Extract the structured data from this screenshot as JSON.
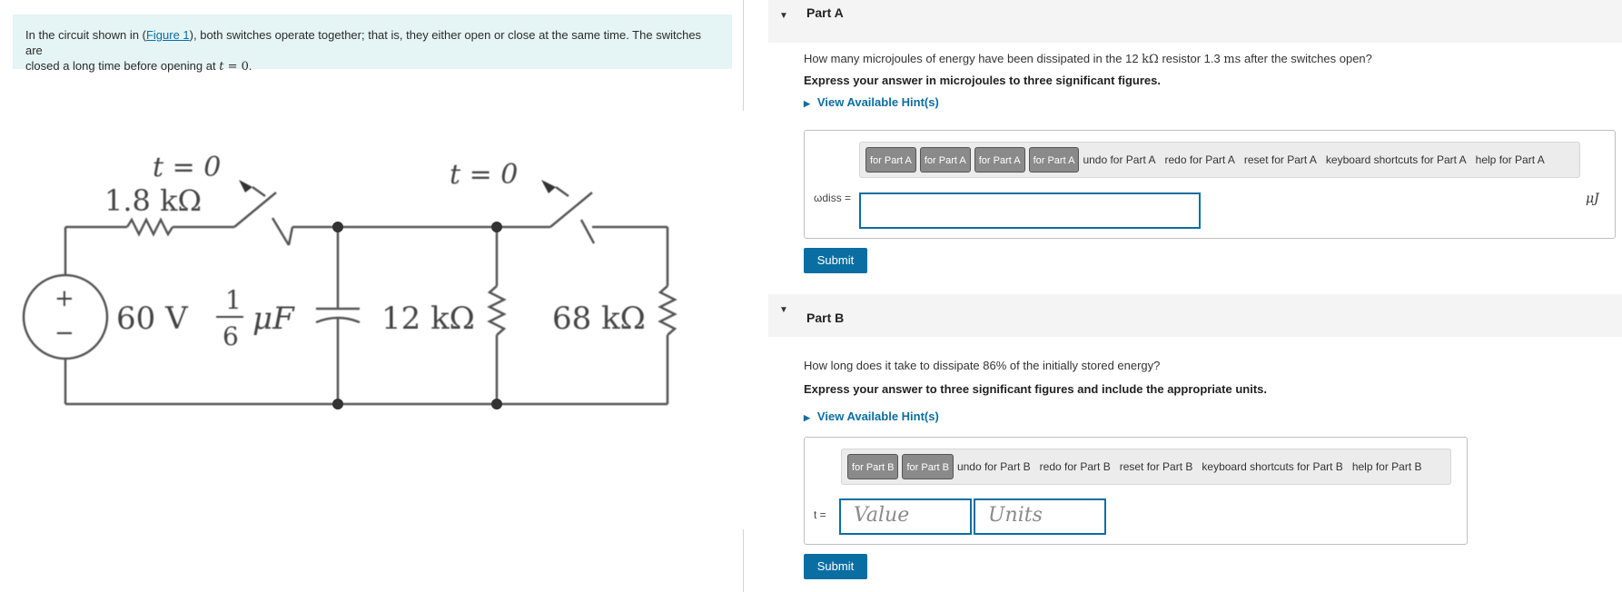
{
  "problem": {
    "text_before_link": "In the circuit shown in (",
    "figure_link": "Figure 1",
    "text_after_link": "), both switches operate together; that is, they either open or close at the same time. The switches are",
    "text_line2_prefix": "closed a long time before opening at ",
    "t_var": "t",
    "eq_zero": " = 0",
    "period": "."
  },
  "circuit": {
    "switch1_label": "t = 0",
    "switch2_label": "t = 0",
    "r1_label": "1.8 kΩ",
    "source_label": "60 V",
    "frac_num": "1",
    "frac_den": "6",
    "cap_unit": "μF",
    "r2_label": "12 kΩ",
    "r3_label": "68 kΩ",
    "plus_sign": "+",
    "minus_sign": "−"
  },
  "partA": {
    "title": "Part A",
    "question_pre": "How many microjoules of energy have been dissipated in the 12 ",
    "q_unit_k": "kΩ",
    "question_mid": " resistor 1.3 ",
    "q_unit_ms": "ms",
    "question_post": " after the switches open?",
    "instruction": "Express your answer in microjoules to three significant figures.",
    "hint": "View Available Hint(s)",
    "toolbar_buttons": [
      "for Part A",
      "for Part A",
      "for Part A",
      "for Part A"
    ],
    "toolbar_labels": [
      "undo for Part A",
      "redo for Part A",
      "reset for Part A",
      "keyboard shortcuts for Part A",
      "help for Part A"
    ],
    "var_label": "ωdiss =",
    "unit": "μJ",
    "submit": "Submit"
  },
  "partB": {
    "title": "Part B",
    "question": "How long does it take to dissipate 86% of the initially stored energy?",
    "instruction": "Express your answer to three significant figures and include the appropriate units.",
    "hint": "View Available Hint(s)",
    "toolbar_buttons": [
      "for Part B",
      "for Part B"
    ],
    "toolbar_labels": [
      "undo for Part B",
      "redo for Part B",
      "reset for Part B",
      "keyboard shortcuts for Part B",
      "help for Part B"
    ],
    "var_label": "t =",
    "value_placeholder": "Value",
    "units_placeholder": "Units",
    "submit": "Submit"
  },
  "colors": {
    "accent": "#0a6ea3",
    "problem_bg": "#e5f4f4",
    "header_bg": "#f4f4f4"
  }
}
